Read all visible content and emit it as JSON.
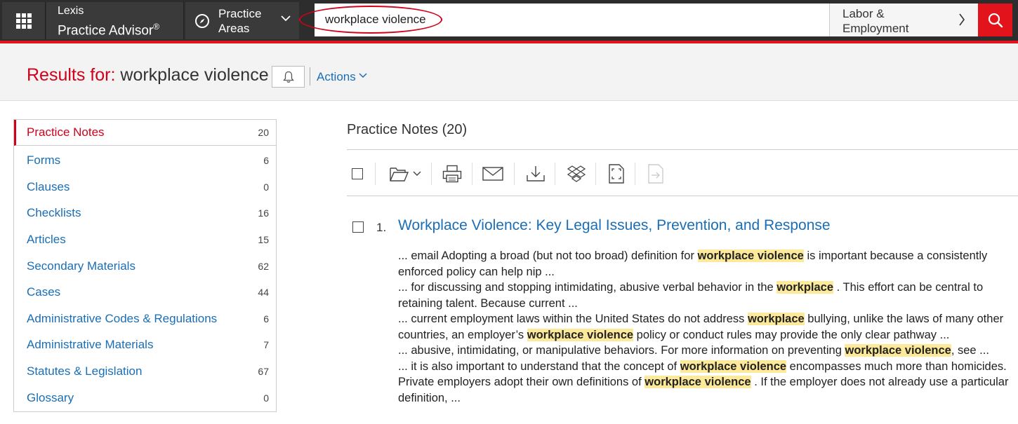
{
  "header": {
    "brand_line1": "Lexis",
    "brand_line2": "Practice Advisor",
    "brand_reg": "®",
    "practice_line1": "Practice",
    "practice_line2": "Areas",
    "search_value": "workplace violence",
    "scope_line1": "Labor &",
    "scope_line2": "Employment",
    "icons": [
      "grid-icon",
      "compass-icon",
      "chevron-down-icon",
      "chevron-right-icon",
      "search-icon"
    ],
    "accent_color": "#e3131b"
  },
  "results": {
    "label": "Results for:",
    "query": "workplace violence",
    "actions_label": "Actions"
  },
  "sidebar": {
    "items": [
      {
        "label": "Practice Notes",
        "count": "20"
      },
      {
        "label": "Forms",
        "count": "6"
      },
      {
        "label": "Clauses",
        "count": "0"
      },
      {
        "label": "Checklists",
        "count": "16"
      },
      {
        "label": "Articles",
        "count": "15"
      },
      {
        "label": "Secondary Materials",
        "count": "62"
      },
      {
        "label": "Cases",
        "count": "44"
      },
      {
        "label": "Administrative Codes & Regulations",
        "count": "6"
      },
      {
        "label": "Administrative Materials",
        "count": "7"
      },
      {
        "label": "Statutes & Legislation",
        "count": "67"
      },
      {
        "label": "Glossary",
        "count": "0"
      }
    ]
  },
  "main": {
    "title": "Practice Notes (20)",
    "toolbar_icons": [
      "folder-icon",
      "print-icon",
      "email-icon",
      "download-icon",
      "dropbox-icon",
      "fullscreen-doc-icon",
      "export-icon"
    ],
    "result": {
      "number": "1.",
      "title": "Workplace Violence: Key Legal Issues, Prevention, and Response",
      "snippet": [
        [
          "... email Adopting a broad (but not too broad) definition for ",
          {
            "hl": "workplace violence"
          },
          " is important because a consistently enforced policy can help nip ..."
        ],
        [
          "... for discussing and stopping intimidating, abusive verbal behavior in the ",
          {
            "hl": "workplace"
          },
          " . This effort can be central to retaining talent. Because current ..."
        ],
        [
          "... current employment laws within the United States do not address ",
          {
            "hl": "workplace"
          },
          " bullying, unlike the laws of many other countries, an employer’s ",
          {
            "hl": "workplace violence"
          },
          " policy or conduct rules may provide the only clear pathway ..."
        ],
        [
          "... abusive, intimidating, or manipulative behaviors. For more information on preventing ",
          {
            "hl": "workplace violence"
          },
          ", see ..."
        ],
        [
          "... it is also important to understand that the concept of ",
          {
            "hl": "workplace violence"
          },
          " encompasses much more than homicides. Private employers adopt their own definitions of ",
          {
            "hl": "workplace violence"
          },
          " . If the employer does not already use a particular definition, ..."
        ]
      ]
    }
  }
}
